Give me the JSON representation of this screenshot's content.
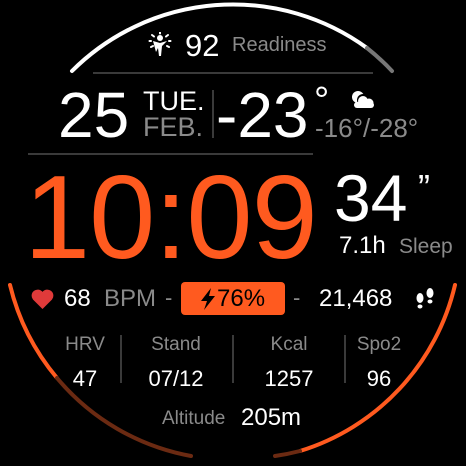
{
  "colors": {
    "accent": "#ff5a1f",
    "accent_dark": "#6b2a12",
    "muted": "#8a8a8a",
    "heart": "#e03a3a"
  },
  "readiness": {
    "icon": "readiness-figure-icon",
    "value": "92",
    "label": "Readiness",
    "progress": 0.88
  },
  "date": {
    "day": "25",
    "weekday": "TUE.",
    "month": "FEB."
  },
  "weather": {
    "temp": "-23",
    "degree": "°",
    "icon": "partly-cloudy-icon",
    "range": "-16°/-28°"
  },
  "time": {
    "hhmm": "10:09",
    "seconds": "34",
    "seconds_mark": "”"
  },
  "sleep": {
    "value": "7.1h",
    "label": "Sleep"
  },
  "heart": {
    "icon": "heart-icon",
    "value": "68",
    "unit": "BPM"
  },
  "battery": {
    "icon": "lightning-icon",
    "value": "76%",
    "level": 0.76
  },
  "separators": {
    "dash": "-"
  },
  "steps": {
    "value": "21,468",
    "icon": "footsteps-icon"
  },
  "stats": [
    {
      "label": "HRV",
      "value": "47"
    },
    {
      "label": "Stand",
      "value": "07/12"
    },
    {
      "label": "Kcal",
      "value": "1257"
    },
    {
      "label": "Spo2",
      "value": "96"
    }
  ],
  "altitude": {
    "label": "Altitude",
    "value": "205m"
  }
}
